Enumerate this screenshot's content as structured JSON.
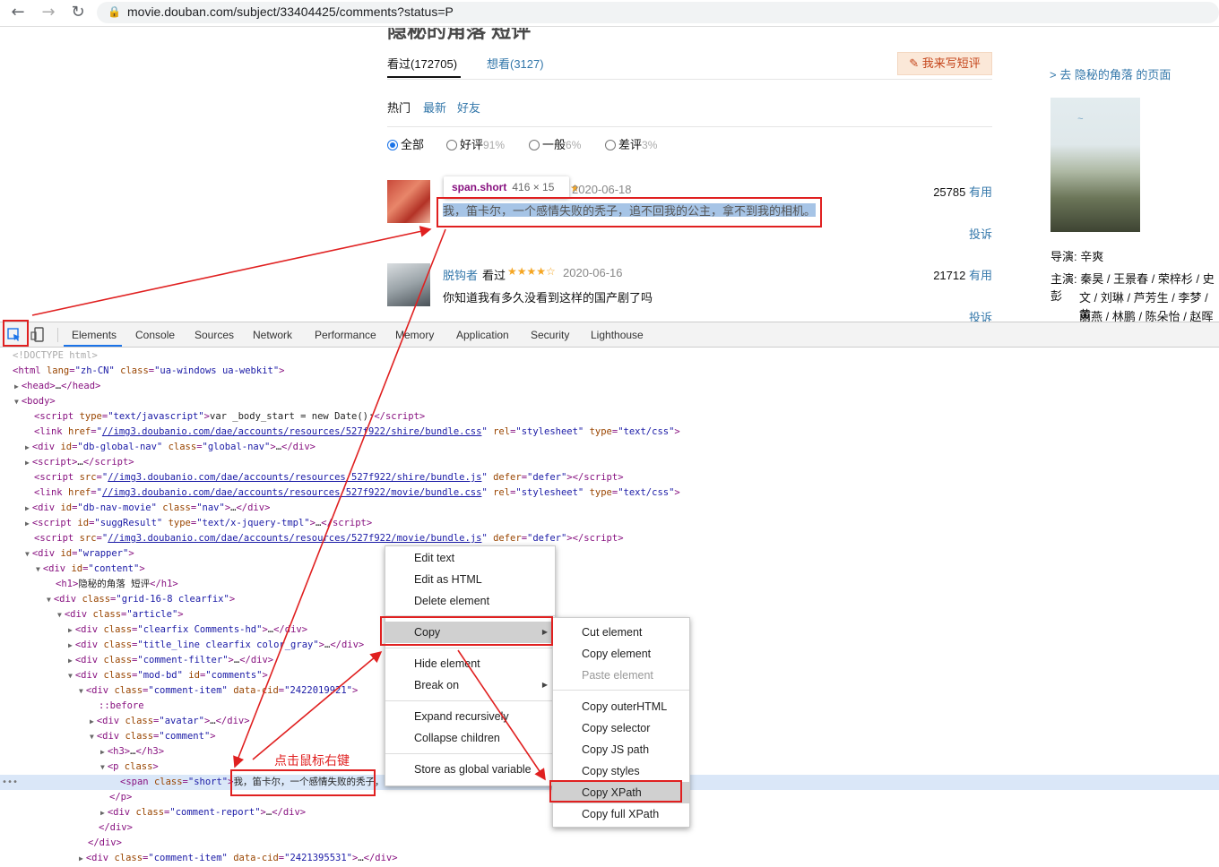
{
  "browser": {
    "url": "movie.douban.com/subject/33404425/comments?status=P",
    "back_icon": "←",
    "forward_icon": "→",
    "reload_icon": "↻"
  },
  "page": {
    "title": "隐秘的角落 短评",
    "tabs": [
      "看过(172705)",
      "想看(3127)"
    ],
    "write_button": "我来写短评",
    "sort": [
      "热门",
      "最新",
      "好友"
    ],
    "filters": [
      {
        "label": "全部",
        "pct": "",
        "checked": true
      },
      {
        "label": "好评",
        "pct": "91%",
        "checked": false
      },
      {
        "label": "一般",
        "pct": "6%",
        "checked": false
      },
      {
        "label": "差评",
        "pct": "3%",
        "checked": false
      }
    ],
    "tooltip": {
      "name": "span.short",
      "size": "416 × 15"
    },
    "comments": [
      {
        "date": "2020-06-18",
        "votes": "25785",
        "votes_label": "有用",
        "text": "我，笛卡尔，一个感情失败的秃子，追不回我的公主，拿不到我的相机。",
        "report": "投诉"
      },
      {
        "user": "脱钩者",
        "state": "看过",
        "stars": "★★★★☆",
        "date": "2020-06-16",
        "votes": "21712",
        "votes_label": "有用",
        "text": "你知道我有多久没看到这样的国产剧了吗",
        "report": "投诉"
      }
    ],
    "sidebar": {
      "link": "> 去 隐秘的角落 的页面",
      "director_label": "导演:",
      "director": "辛爽",
      "cast_label": "主演:",
      "cast_lines": [
        "秦昊 / 王景春 / 荣梓杉 / 史彭",
        "文 / 刘琳 / 芦芳生 / 李梦 / 黄",
        "丽燕 / 林鹏 / 陈朵怡 / 赵晖 /"
      ]
    }
  },
  "devtools": {
    "tabs": [
      "Elements",
      "Console",
      "Sources",
      "Network",
      "Performance",
      "Memory",
      "Application",
      "Security",
      "Lighthouse"
    ],
    "context_menu": [
      "Edit text",
      "Edit as HTML",
      "Delete element",
      "Copy",
      "Hide element",
      "Break on",
      "Expand recursively",
      "Collapse children",
      "Store as global variable"
    ],
    "copy_submenu": [
      {
        "label": "Cut element",
        "disabled": false
      },
      {
        "label": "Copy element",
        "disabled": false
      },
      {
        "label": "Paste element",
        "disabled": true
      },
      {
        "label": "Copy outerHTML",
        "disabled": false
      },
      {
        "label": "Copy selector",
        "disabled": false
      },
      {
        "label": "Copy JS path",
        "disabled": false
      },
      {
        "label": "Copy styles",
        "disabled": false
      },
      {
        "label": "Copy XPath",
        "disabled": false
      },
      {
        "label": "Copy full XPath",
        "disabled": false
      }
    ],
    "selected_text": "我，笛卡尔，一个感情失败的秃子，追不回我的公主，拿不到我的相",
    "annotation": "点击鼠标右键"
  }
}
